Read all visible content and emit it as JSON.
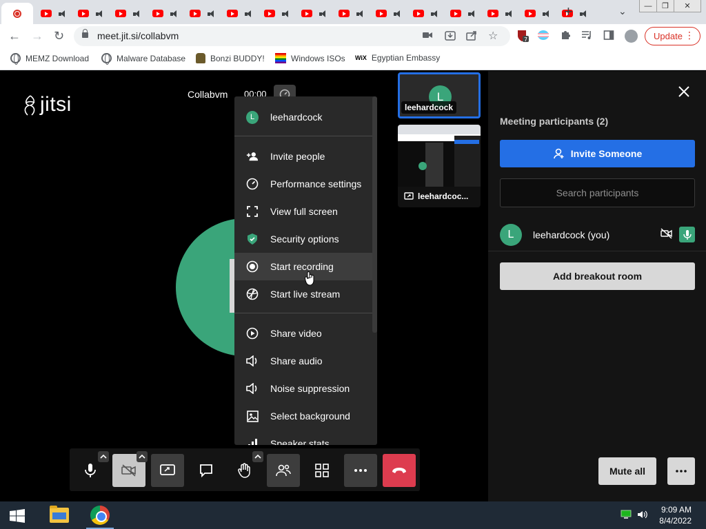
{
  "browser": {
    "url": "meet.jit.si/collabvm",
    "update_label": "Update",
    "tab_count": 15
  },
  "bookmarks": [
    {
      "label": "MEMZ Download",
      "icon": "globe-icon"
    },
    {
      "label": "Malware Database",
      "icon": "globe-icon"
    },
    {
      "label": "Bonzi BUDDY!",
      "icon": "bonzi-icon"
    },
    {
      "label": "Windows ISOs",
      "icon": "rainbow-flag-icon"
    },
    {
      "label": "Egyptian Embassy",
      "icon": "wix-icon"
    }
  ],
  "meeting": {
    "logo": "jitsi",
    "name": "Collabvm",
    "timer": "00:00"
  },
  "thumbnails": [
    {
      "name": "leehardcock",
      "initial": "L"
    },
    {
      "name": "leehardcoc..."
    }
  ],
  "menu": {
    "user": {
      "name": "leehardcock",
      "initial": "L"
    },
    "items": [
      {
        "label": "Invite people",
        "icon": "add-person-icon"
      },
      {
        "label": "Performance settings",
        "icon": "gauge-icon"
      },
      {
        "label": "View full screen",
        "icon": "fullscreen-icon"
      },
      {
        "label": "Security options",
        "icon": "shield-icon"
      },
      {
        "label": "Start recording",
        "icon": "record-icon"
      },
      {
        "label": "Start live stream",
        "icon": "livestream-icon"
      },
      {
        "label": "Share video",
        "icon": "play-circle-icon"
      },
      {
        "label": "Share audio",
        "icon": "speaker-icon"
      },
      {
        "label": "Noise suppression",
        "icon": "speaker-icon"
      },
      {
        "label": "Select background",
        "icon": "image-icon"
      },
      {
        "label": "Speaker stats",
        "icon": "bar-chart-icon"
      }
    ]
  },
  "participants_pane": {
    "title": "Meeting participants (2)",
    "invite_label": "Invite Someone",
    "search_placeholder": "Search participants",
    "participant": {
      "name": "leehardcock (you)",
      "initial": "L"
    },
    "breakout_label": "Add breakout room",
    "mute_all_label": "Mute all"
  },
  "taskbar": {
    "time": "9:09 AM",
    "date": "8/4/2022"
  },
  "colors": {
    "accent": "#246fe5",
    "avatar": "#3aa57a",
    "hangup": "#dd3c4f",
    "pane_bg": "#141414",
    "menu_bg": "#292929"
  }
}
